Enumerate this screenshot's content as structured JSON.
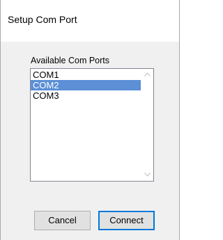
{
  "window": {
    "title": "Setup Com Port"
  },
  "ports": {
    "label": "Available Com Ports",
    "items": [
      {
        "label": "COM1",
        "selected": false
      },
      {
        "label": "COM2",
        "selected": true
      },
      {
        "label": "COM3",
        "selected": false
      }
    ]
  },
  "buttons": {
    "cancel_label": "Cancel",
    "connect_label": "Connect"
  },
  "colors": {
    "selection": "#5b8fd6",
    "default_button_border": "#0078d7"
  },
  "icons": {
    "scroll_up": "chevron-up-icon",
    "scroll_down": "chevron-down-icon"
  }
}
